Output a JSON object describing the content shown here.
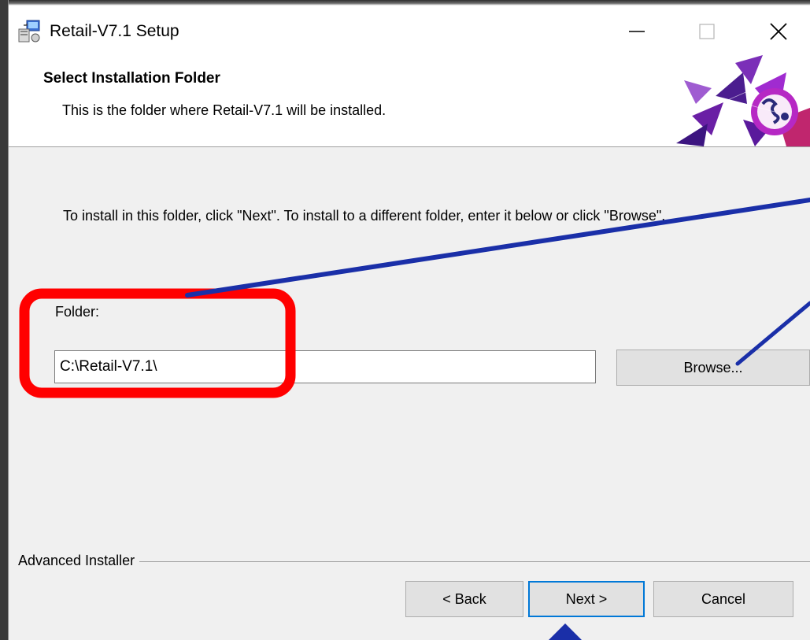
{
  "window": {
    "title": "Retail-V7.1 Setup",
    "caption_buttons": [
      "minimize-icon",
      "maximize-icon",
      "close-icon"
    ]
  },
  "header": {
    "title": "Select Installation Folder",
    "subtitle": "This is the folder where Retail-V7.1 will be installed."
  },
  "main": {
    "instruction": "To install in this folder, click \"Next\". To install to a different folder, enter it below or click \"Browse\".",
    "folder_label": "Folder:",
    "folder_value": "C:\\Retail-V7.1\\",
    "browse_label": "Browse..."
  },
  "footer": {
    "brand": "Advanced Installer",
    "back_label": "< Back",
    "next_label": "Next >",
    "cancel_label": "Cancel"
  },
  "colors": {
    "dialog_bg": "#f0f0f0",
    "focus_border": "#0078d7",
    "highlight_red": "#ff0000",
    "annotation_blue": "#1a2fa8"
  }
}
